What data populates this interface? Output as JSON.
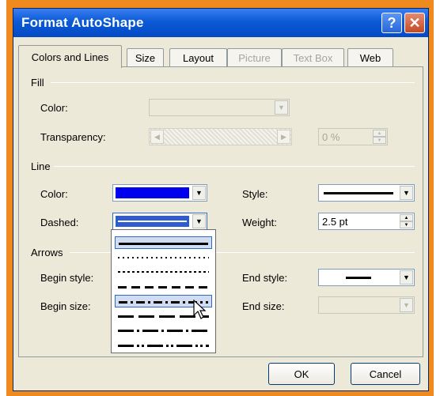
{
  "window": {
    "title": "Format AutoShape",
    "help_label": "?",
    "close_label": "✕"
  },
  "tabs": [
    {
      "label": "Colors and Lines",
      "state": "active"
    },
    {
      "label": "Size",
      "state": "normal"
    },
    {
      "label": "Layout",
      "state": "normal"
    },
    {
      "label": "Picture",
      "state": "disabled"
    },
    {
      "label": "Text Box",
      "state": "disabled"
    },
    {
      "label": "Web",
      "state": "normal"
    }
  ],
  "fill": {
    "section_label": "Fill",
    "color_label": "Color:",
    "transparency_label": "Transparency:",
    "transparency_value": "0 %"
  },
  "line": {
    "section_label": "Line",
    "color_label": "Color:",
    "color_value": "#0000ee",
    "dashed_label": "Dashed:",
    "dashed_value_color": "#2f5bd0",
    "style_label": "Style:",
    "weight_label": "Weight:",
    "weight_value": "2.5 pt"
  },
  "arrows": {
    "section_label": "Arrows",
    "begin_style_label": "Begin style:",
    "begin_size_label": "Begin size:",
    "end_style_label": "End style:",
    "end_size_label": "End size:"
  },
  "dash_options": [
    {
      "name": "solid",
      "selected": false,
      "highlighted": true
    },
    {
      "name": "round-dot",
      "selected": false,
      "highlighted": false
    },
    {
      "name": "square-dot",
      "selected": false,
      "highlighted": false
    },
    {
      "name": "dash",
      "selected": false,
      "highlighted": false
    },
    {
      "name": "dash-dot",
      "selected": true,
      "highlighted": false
    },
    {
      "name": "long-dash",
      "selected": false,
      "highlighted": false
    },
    {
      "name": "long-dash-dot",
      "selected": false,
      "highlighted": false
    },
    {
      "name": "long-dash-dot-dot",
      "selected": false,
      "highlighted": false
    }
  ],
  "buttons": {
    "ok_label": "OK",
    "cancel_label": "Cancel"
  },
  "icons": {
    "dropdown_arrow": "chevron-down-icon",
    "cursor": "mouse-pointer-icon"
  }
}
